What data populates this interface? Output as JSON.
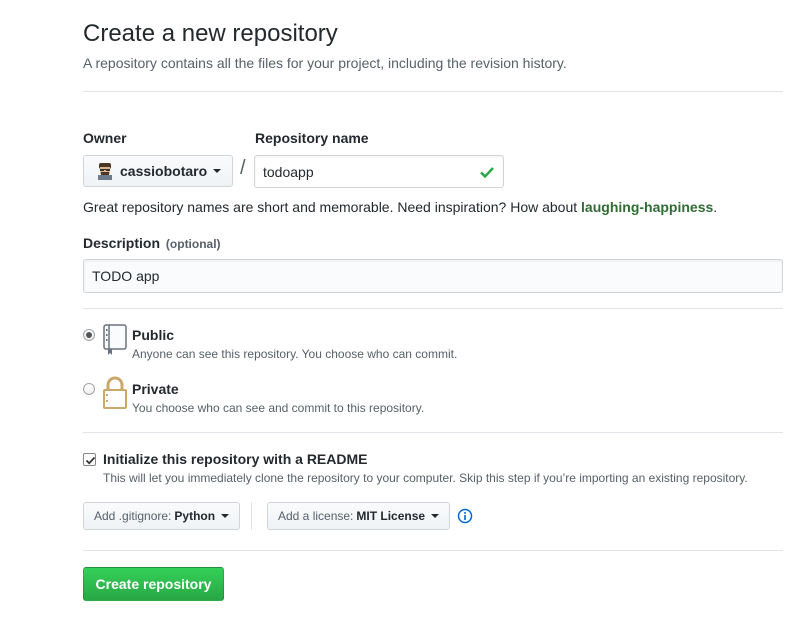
{
  "header": {
    "title": "Create a new repository",
    "subtitle": "A repository contains all the files for your project, including the revision history."
  },
  "owner": {
    "label": "Owner",
    "value": "cassiobotaro"
  },
  "repo_name": {
    "label": "Repository name",
    "value": "todoapp",
    "separator": "/"
  },
  "hint": {
    "text": "Great repository names are short and memorable. Need inspiration? How about ",
    "suggestion": "laughing-happiness",
    "end": "."
  },
  "description": {
    "label": "Description",
    "optional": "(optional)",
    "value": "TODO app"
  },
  "visibility": {
    "public": {
      "title": "Public",
      "desc": "Anyone can see this repository. You choose who can commit.",
      "selected": true
    },
    "private": {
      "title": "Private",
      "desc": "You choose who can see and commit to this repository.",
      "selected": false
    }
  },
  "init": {
    "title": "Initialize this repository with a README",
    "desc": "This will let you immediately clone the repository to your computer. Skip this step if you’re importing an existing repository.",
    "checked": true
  },
  "gitignore": {
    "prefix": "Add .gitignore:",
    "value": "Python"
  },
  "license": {
    "prefix": "Add a license:",
    "value": "MIT License"
  },
  "submit": {
    "label": "Create repository"
  },
  "colors": {
    "accent_green": "#28a745",
    "suggestion": "#2f6d33",
    "info_blue": "#0366d6"
  },
  "icons": [
    "avatar",
    "check-icon",
    "repo-icon",
    "lock-icon",
    "info-icon",
    "caret-down-icon"
  ]
}
